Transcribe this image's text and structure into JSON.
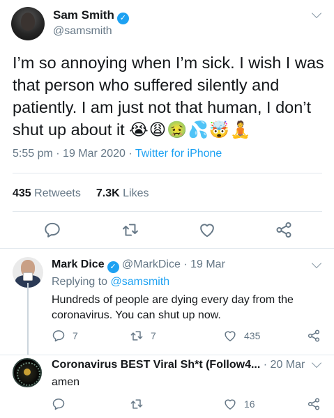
{
  "main_tweet": {
    "author_name": "Sam Smith",
    "author_handle": "@samsmith",
    "text": "I’m so annoying when I’m sick. I wish I was that person who suffered silently and patiently. I am just not that human, I don’t shut up about it",
    "emojis": "😭😩🤢💦🤯🧘",
    "time": "5:55 pm",
    "date": "19 Mar 2020",
    "source": "Twitter for iPhone",
    "retweets_count": "435",
    "retweets_label": "Retweets",
    "likes_count": "7.3K",
    "likes_label": "Likes"
  },
  "replies": [
    {
      "author_name": "Mark Dice",
      "author_handle": "@MarkDice",
      "date": "19 Mar",
      "replying_label": "Replying to",
      "replying_handle": "@samsmith",
      "text_line1": "Hundreds of people are dying every day from the",
      "text_line2": "coronavirus.  You can shut up now.",
      "reply_count": "7",
      "retweet_count": "7",
      "like_count": "435"
    },
    {
      "author_name": "Coronavirus BEST Viral Sh*t (Follow4...",
      "date": "20 Mar",
      "text": "amen",
      "like_count": "16"
    }
  ],
  "icons": [
    "verified-badge-icon",
    "chevron-down-icon",
    "reply-icon",
    "retweet-icon",
    "like-icon",
    "share-icon"
  ],
  "colors": {
    "link": "#1da1f2",
    "muted": "#657786",
    "divider": "#e1e8ed",
    "text": "#14171a"
  }
}
